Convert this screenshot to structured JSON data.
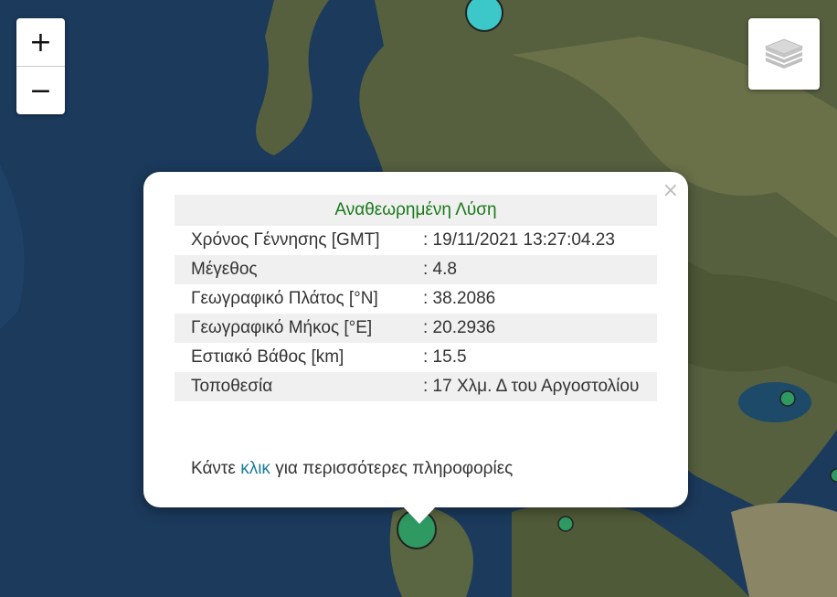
{
  "map": {
    "colors": {
      "sea": "#1b3a5c",
      "land": "#5a6540",
      "marker_green": "#2e9a62",
      "marker_cyan": "#3cc8c8"
    },
    "markers": [
      {
        "name": "marker-north",
        "color": "#3cc8c8"
      },
      {
        "name": "marker-selected",
        "color": "#2e9a62"
      },
      {
        "name": "marker-small-1",
        "color": "#2e9a62"
      },
      {
        "name": "marker-small-2",
        "color": "#2e9a62"
      },
      {
        "name": "marker-edge",
        "color": "#2e9a62"
      }
    ]
  },
  "controls": {
    "zoom_in": "+",
    "zoom_out": "−",
    "layers_icon": "layers-icon"
  },
  "popup": {
    "close": "×",
    "header": "Αναθεωρημένη Λύση",
    "rows": [
      {
        "label": "Χρόνος Γέννησης [GMT]",
        "value": ": 19/11/2021 13:27:04.23"
      },
      {
        "label": "Μέγεθος",
        "value": ": 4.8"
      },
      {
        "label": "Γεωγραφικό Πλάτος [°N]",
        "value": ": 38.2086"
      },
      {
        "label": "Γεωγραφικό Μήκος [°E]",
        "value": ": 20.2936"
      },
      {
        "label": "Εστιακό Βάθος [km]",
        "value": ": 15.5"
      },
      {
        "label": "Τοποθεσία",
        "value": ": 17 Χλμ. Δ του Αργοστολίου"
      }
    ],
    "more_before": "Κάντε ",
    "more_link": "κλικ",
    "more_after": " για περισσότερες πληροφορίες"
  }
}
